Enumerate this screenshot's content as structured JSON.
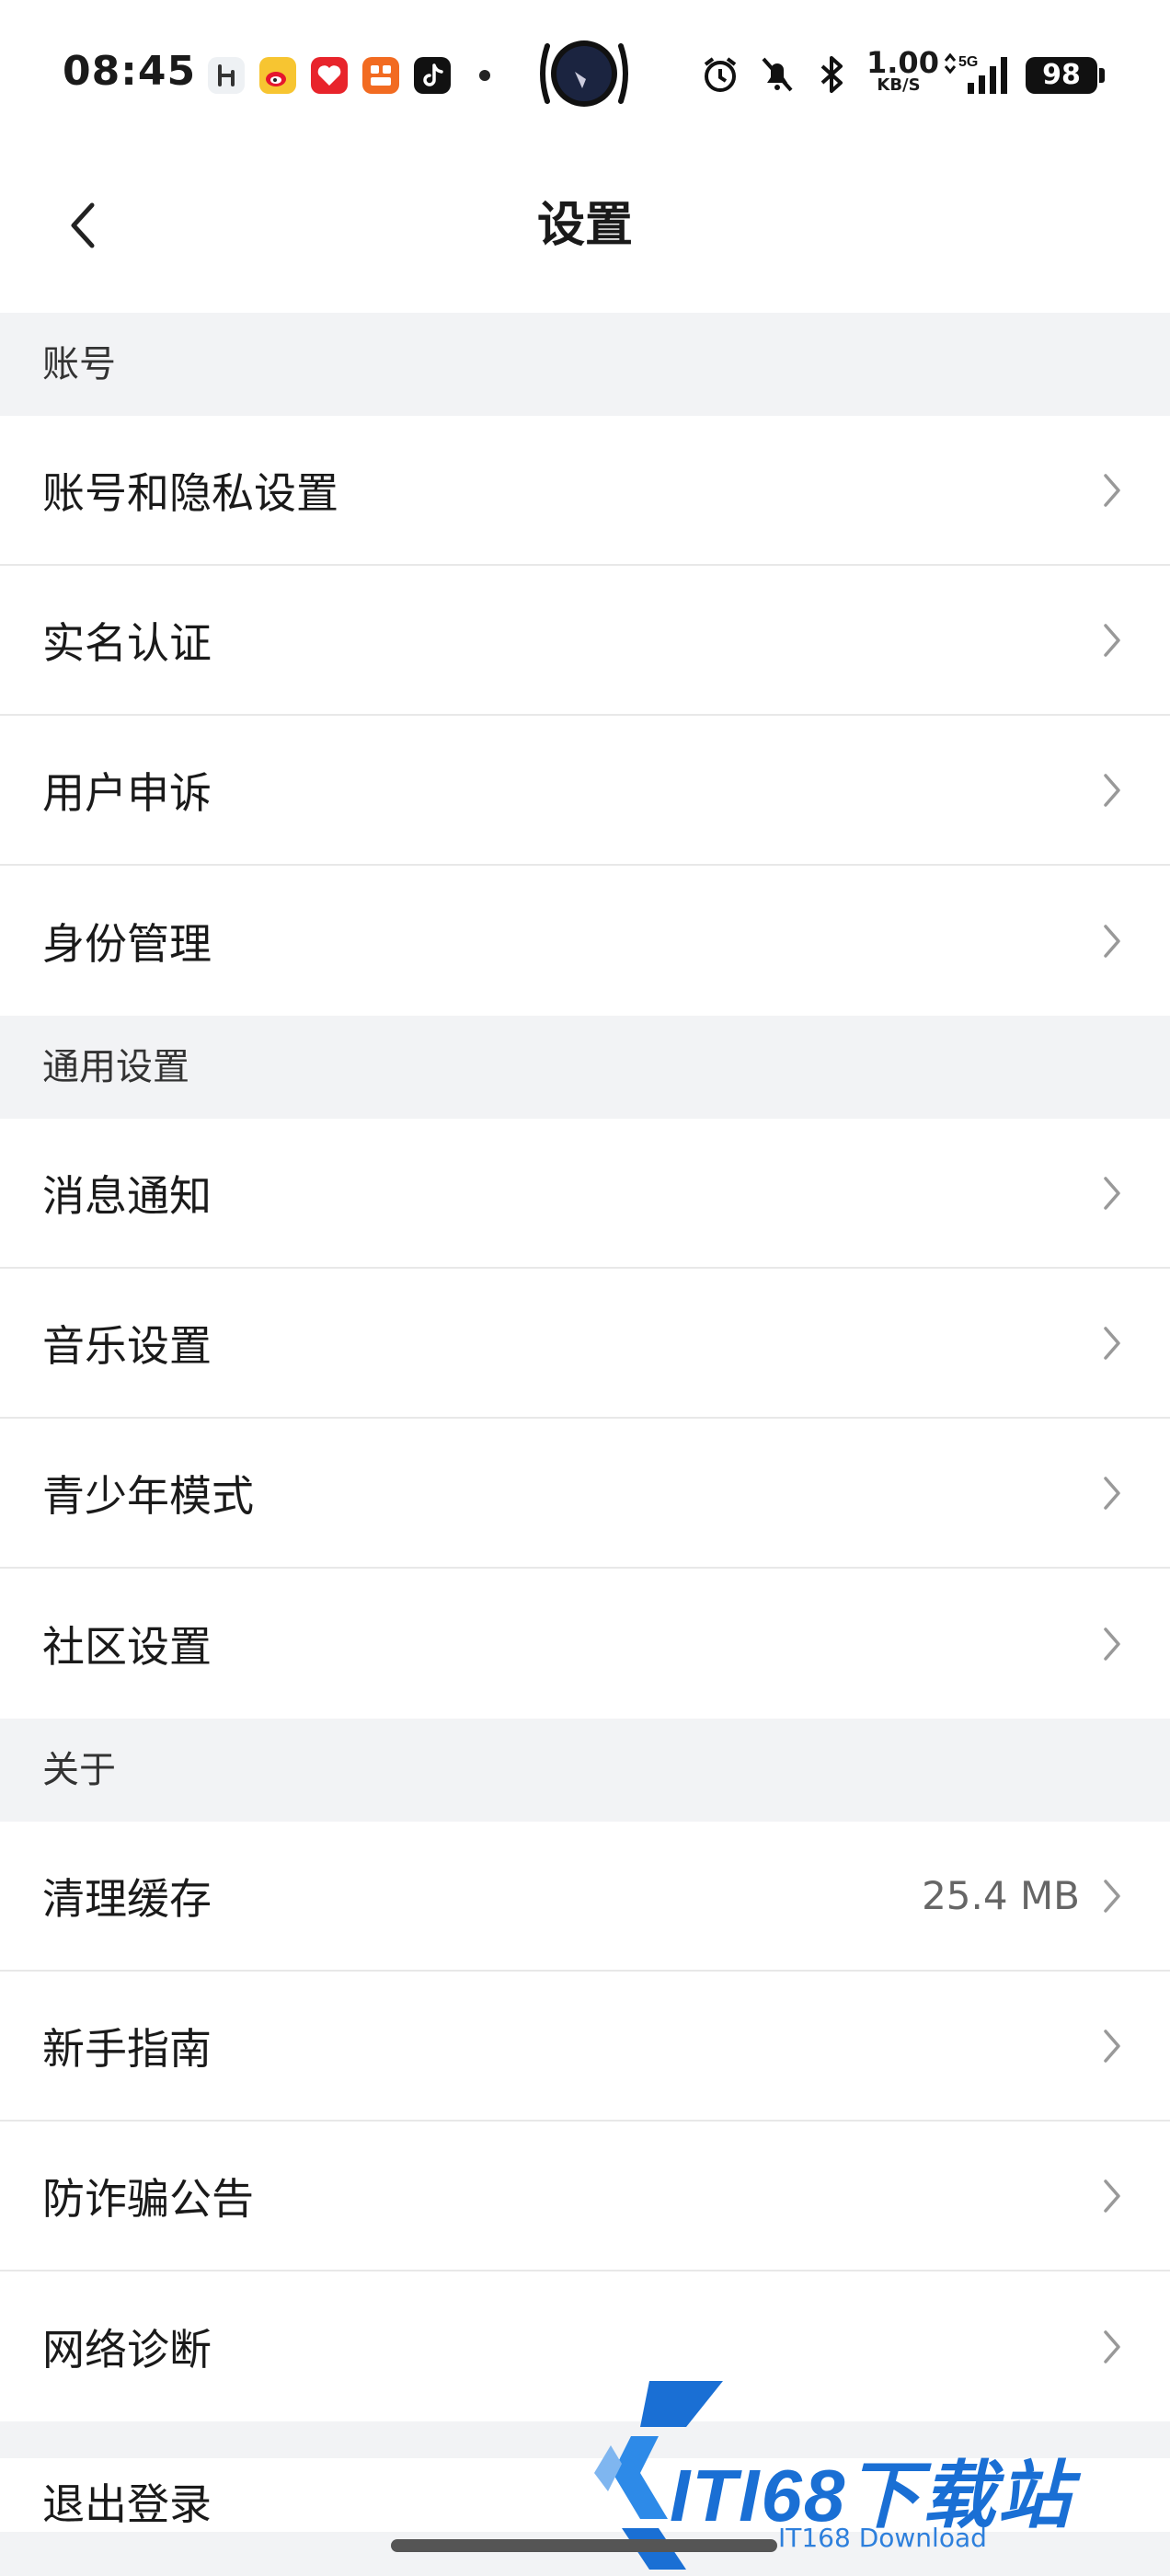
{
  "status_bar": {
    "time": "08:45",
    "net_speed_value": "1.00",
    "net_speed_unit": "KB/S",
    "network": "5G",
    "battery": "98",
    "app_icons": [
      "app-hub-icon",
      "weibo-icon",
      "app-red-icon",
      "app-orange-icon",
      "tiktok-icon"
    ],
    "system_icons": [
      "alarm-icon",
      "mute-icon",
      "bluetooth-icon",
      "signal-icon"
    ]
  },
  "header": {
    "title": "设置"
  },
  "sections": [
    {
      "title": "账号",
      "items": [
        {
          "label": "账号和隐私设置",
          "value": ""
        },
        {
          "label": "实名认证",
          "value": ""
        },
        {
          "label": "用户申诉",
          "value": ""
        },
        {
          "label": "身份管理",
          "value": ""
        }
      ]
    },
    {
      "title": "通用设置",
      "items": [
        {
          "label": "消息通知",
          "value": ""
        },
        {
          "label": "音乐设置",
          "value": ""
        },
        {
          "label": "青少年模式",
          "value": ""
        },
        {
          "label": "社区设置",
          "value": ""
        }
      ]
    },
    {
      "title": "关于",
      "items": [
        {
          "label": "清理缓存",
          "value": "25.4 MB"
        },
        {
          "label": "新手指南",
          "value": ""
        },
        {
          "label": "防诈骗公告",
          "value": ""
        },
        {
          "label": "网络诊断",
          "value": ""
        }
      ]
    }
  ],
  "logout_label": "退出登录",
  "watermark": {
    "title": "ITI68下载站",
    "subtitle": "IT168 Download"
  },
  "colors": {
    "background": "#f2f3f5",
    "surface": "#ffffff",
    "text": "#1a1a1a",
    "secondary_text": "#666666",
    "watermark_blue": "#1a6fd4"
  }
}
